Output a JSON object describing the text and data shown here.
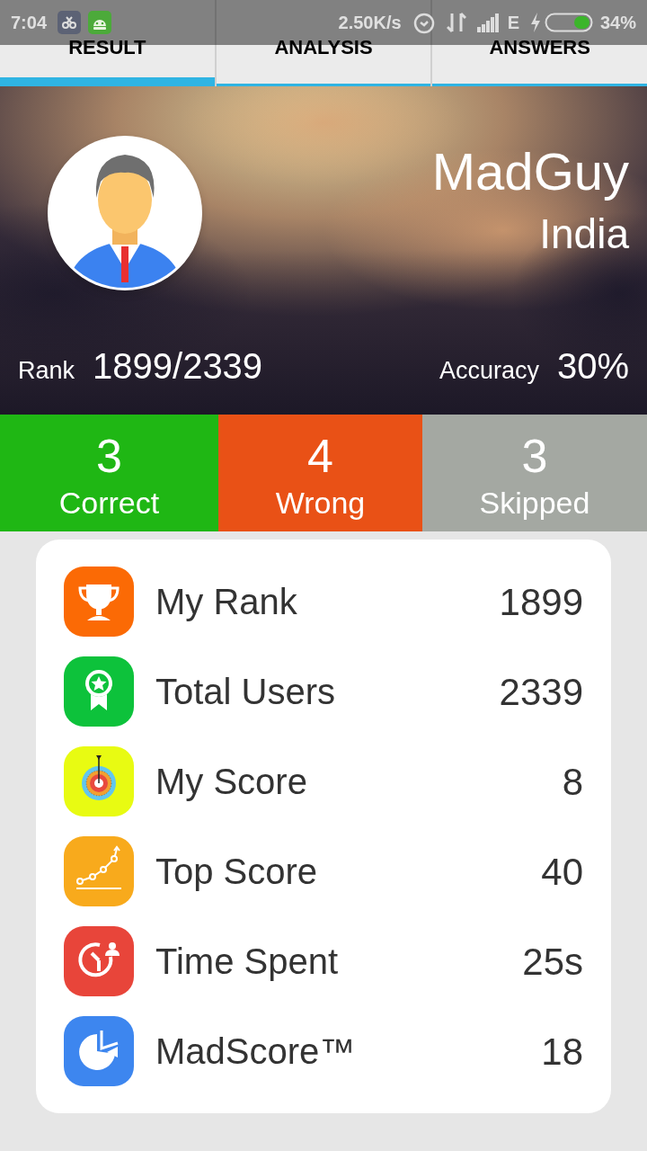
{
  "status_bar": {
    "time": "7:04",
    "speed": "2.50K/s",
    "network": "E",
    "battery": "34%"
  },
  "tabs": [
    {
      "label": "RESULT",
      "selected": true
    },
    {
      "label": "ANALYSIS",
      "selected": false
    },
    {
      "label": "ANSWERS",
      "selected": false
    }
  ],
  "profile": {
    "name": "MadGuy",
    "country": "India",
    "rank_label": "Rank",
    "rank": "1899/2339",
    "accuracy_label": "Accuracy",
    "accuracy": "30%"
  },
  "tallies": [
    {
      "count": "3",
      "label": "Correct",
      "color": "#1fb714"
    },
    {
      "count": "4",
      "label": "Wrong",
      "color": "#e95116"
    },
    {
      "count": "3",
      "label": "Skipped",
      "color": "#a4a8a2"
    }
  ],
  "stats": [
    {
      "kind": "trophy",
      "color": "#fb6a05",
      "label": "My Rank",
      "value": "1899"
    },
    {
      "kind": "award",
      "color": "#0dc23b",
      "label": "Total Users",
      "value": "2339"
    },
    {
      "kind": "target",
      "color": "#e8fb12",
      "label": "My Score",
      "value": "8"
    },
    {
      "kind": "chart",
      "color": "#f8aa1c",
      "label": "Top Score",
      "value": "40"
    },
    {
      "kind": "timer",
      "color": "#e8453a",
      "label": "Time Spent",
      "value": "25s"
    },
    {
      "kind": "pie",
      "color": "#3d86ef",
      "label": "MadScore™",
      "value": "18"
    }
  ]
}
